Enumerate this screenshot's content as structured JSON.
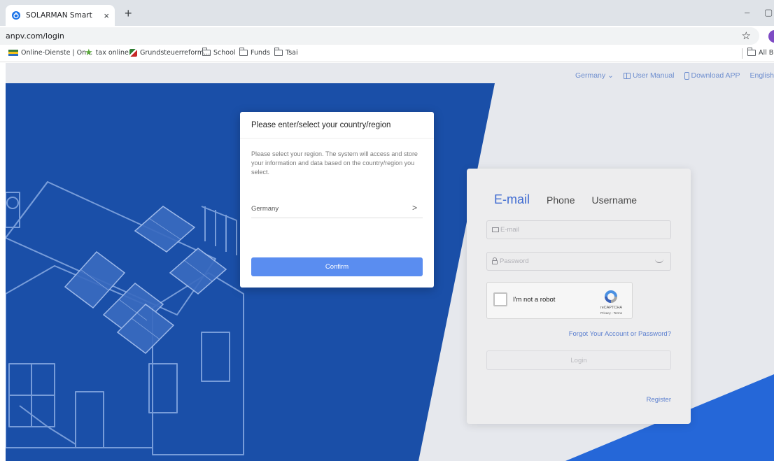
{
  "browser": {
    "tab_title": "SOLARMAN Smart",
    "tab_close": "×",
    "new_tab": "+",
    "minimize": "–",
    "restore": "▢",
    "url": "anpv.com/login",
    "bookmark_star": "☆",
    "bookmarks": [
      {
        "label": "Online-Dienste | On...",
        "icon": "flag-icon"
      },
      {
        "label": "tax online",
        "icon": "star-icon"
      },
      {
        "label": "Grundsteuerreform...",
        "icon": "nrw-icon"
      },
      {
        "label": "School",
        "icon": "folder-icon"
      },
      {
        "label": "Funds",
        "icon": "folder-icon"
      },
      {
        "label": "Tsai",
        "icon": "folder-icon"
      }
    ],
    "all_bookmarks": "All Bo"
  },
  "topnav": {
    "region": "Germany",
    "region_chevron": "⌄",
    "user_manual": "User Manual",
    "download_app": "Download APP",
    "language": "English"
  },
  "login": {
    "tabs": [
      "E-mail",
      "Phone",
      "Username"
    ],
    "email_placeholder": "E-mail",
    "password_placeholder": "Password",
    "captcha_label": "I'm not a robot",
    "captcha_brand": "reCAPTCHA",
    "captcha_terms": "Privacy - Terms",
    "forgot": "Forgot Your Account or Password?",
    "login_button": "Login",
    "register": "Register"
  },
  "modal": {
    "title": "Please enter/select your country/region",
    "description": "Please select your region. The system will access and store your information and data based on the country/region you select.",
    "selected_region": "Germany",
    "chevron": ">",
    "confirm": "Confirm"
  },
  "colors": {
    "brand_blue": "#1a4fa8",
    "accent_blue": "#5a8df0",
    "link_blue": "#5b7fcf"
  }
}
